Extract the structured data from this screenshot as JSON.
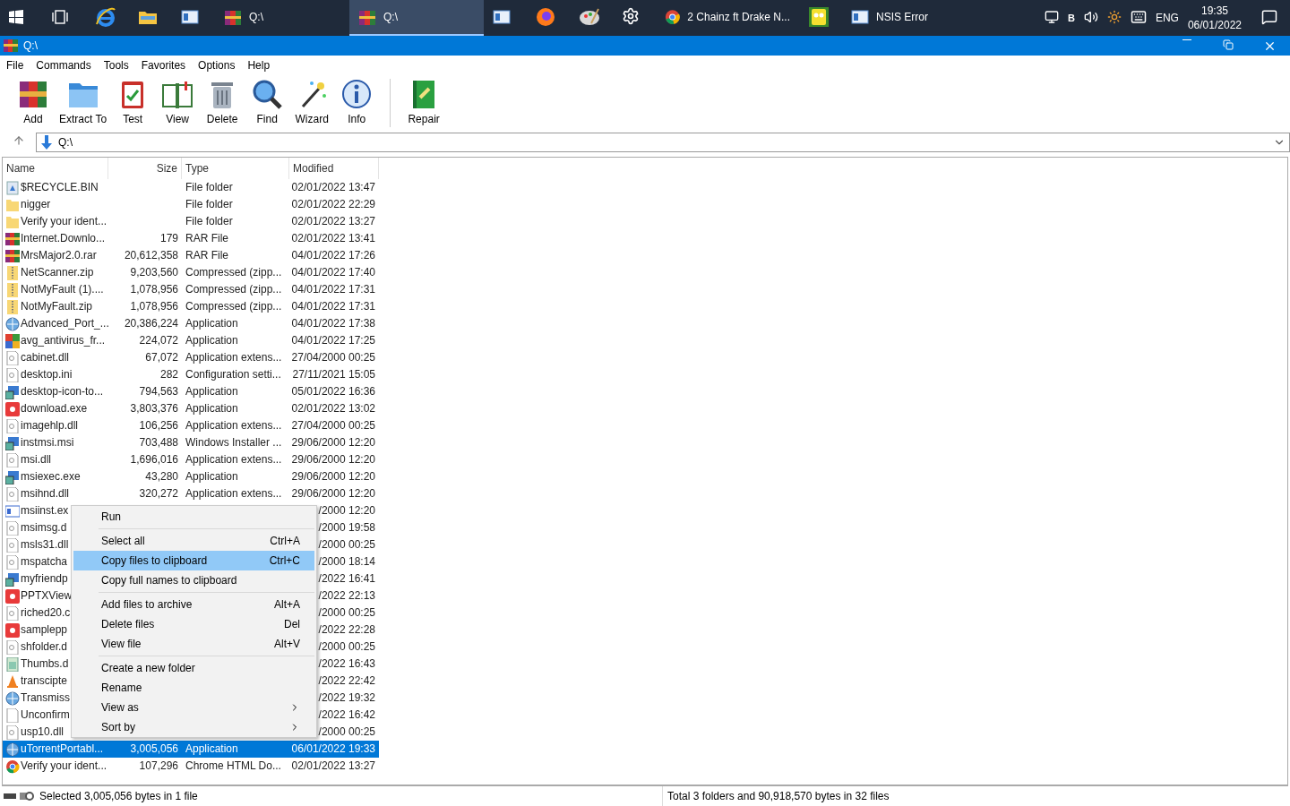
{
  "taskbar": {
    "items": [
      {
        "kind": "start",
        "selected": false
      },
      {
        "kind": "taskview",
        "selected": false
      },
      {
        "kind": "browser",
        "selected": false
      },
      {
        "kind": "explorer",
        "selected": false
      },
      {
        "kind": "app",
        "selected": false
      },
      {
        "kind": "archiver",
        "label": "Q:\\",
        "selected": false
      },
      {
        "kind": "archiver",
        "label": "Q:\\",
        "selected": true
      },
      {
        "kind": "app",
        "selected": false
      },
      {
        "kind": "fox",
        "selected": false
      },
      {
        "kind": "paint",
        "selected": false
      },
      {
        "kind": "gear",
        "selected": false
      },
      {
        "kind": "chrome",
        "label": "2 Chainz ft Drake N...",
        "selected": false
      },
      {
        "kind": "sponge",
        "selected": false
      },
      {
        "kind": "app",
        "label": "NSIS Error",
        "selected": false
      }
    ],
    "tray": {
      "badge": "B",
      "language": "ENG",
      "time": "19:35",
      "date": "06/01/2022"
    }
  },
  "window": {
    "title": "Q:\\"
  },
  "menu": [
    "File",
    "Commands",
    "Tools",
    "Favorites",
    "Options",
    "Help"
  ],
  "toolbar": [
    {
      "label": "Add",
      "kind": "add"
    },
    {
      "label": "Extract To",
      "kind": "extract"
    },
    {
      "label": "Test",
      "kind": "test"
    },
    {
      "label": "View",
      "kind": "view"
    },
    {
      "label": "Delete",
      "kind": "delete"
    },
    {
      "label": "Find",
      "kind": "find"
    },
    {
      "label": "Wizard",
      "kind": "wizard"
    },
    {
      "label": "Info",
      "kind": "info"
    },
    {
      "label": "Repair",
      "kind": "repair"
    }
  ],
  "address": {
    "value": "Q:\\"
  },
  "table": {
    "columns": [
      "Name",
      "Size",
      "Type",
      "Modified"
    ],
    "rows": [
      {
        "kind": "bin",
        "name": "$RECYCLE.BIN",
        "type": "File folder",
        "modified": "02/01/2022 13:47",
        "selected": false
      },
      {
        "kind": "folder",
        "name": "nigger",
        "type": "File folder",
        "modified": "02/01/2022 22:29",
        "selected": false
      },
      {
        "kind": "folder",
        "name": "Verify your ident...",
        "type": "File folder",
        "modified": "02/01/2022 13:27",
        "selected": false
      },
      {
        "kind": "rar",
        "name": "Internet.Downlo...",
        "size": "179",
        "type": "RAR File",
        "modified": "02/01/2022 13:41",
        "selected": false
      },
      {
        "kind": "rar",
        "name": "MrsMajor2.0.rar",
        "size": "20,612,358",
        "type": "RAR File",
        "modified": "04/01/2022 17:26",
        "selected": false
      },
      {
        "kind": "zip",
        "name": "NetScanner.zip",
        "size": "9,203,560",
        "type": "Compressed (zipp...",
        "modified": "04/01/2022 17:40",
        "selected": false
      },
      {
        "kind": "zip",
        "name": "NotMyFault (1)....",
        "size": "1,078,956",
        "type": "Compressed (zipp...",
        "modified": "04/01/2022 17:31",
        "selected": false
      },
      {
        "kind": "zip",
        "name": "NotMyFault.zip",
        "size": "1,078,956",
        "type": "Compressed (zipp...",
        "modified": "04/01/2022 17:31",
        "selected": false
      },
      {
        "kind": "app",
        "name": "Advanced_Port_...",
        "size": "20,386,224",
        "type": "Application",
        "modified": "04/01/2022 17:38",
        "selected": false
      },
      {
        "kind": "color",
        "name": "avg_antivirus_fr...",
        "size": "224,072",
        "type": "Application",
        "modified": "04/01/2022 17:25",
        "selected": false
      },
      {
        "kind": "dll",
        "name": "cabinet.dll",
        "size": "67,072",
        "type": "Application extens...",
        "modified": "27/04/2000 00:25",
        "selected": false
      },
      {
        "kind": "dll",
        "name": "desktop.ini",
        "size": "282",
        "type": "Configuration setti...",
        "modified": "27/11/2021 15:05",
        "selected": false
      },
      {
        "kind": "installer",
        "name": "desktop-icon-to...",
        "size": "794,563",
        "type": "Application",
        "modified": "05/01/2022 16:36",
        "selected": false
      },
      {
        "kind": "red",
        "name": "download.exe",
        "size": "3,803,376",
        "type": "Application",
        "modified": "02/01/2022 13:02",
        "selected": false
      },
      {
        "kind": "dll",
        "name": "imagehlp.dll",
        "size": "106,256",
        "type": "Application extens...",
        "modified": "27/04/2000 00:25",
        "selected": false
      },
      {
        "kind": "installer",
        "name": "instmsi.msi",
        "size": "703,488",
        "type": "Windows Installer ...",
        "modified": "29/06/2000 12:20",
        "selected": false
      },
      {
        "kind": "dll",
        "name": "msi.dll",
        "size": "1,696,016",
        "type": "Application extens...",
        "modified": "29/06/2000 12:20",
        "selected": false
      },
      {
        "kind": "installer",
        "name": "msiexec.exe",
        "size": "43,280",
        "type": "Application",
        "modified": "29/06/2000 12:20",
        "selected": false
      },
      {
        "kind": "dll",
        "name": "msihnd.dll",
        "size": "320,272",
        "type": "Application extens...",
        "modified": "29/06/2000 12:20",
        "selected": false
      },
      {
        "kind": "window",
        "name": "msiinst.ex",
        "modified": "/2000 12:20",
        "selected": false
      },
      {
        "kind": "dll",
        "name": "msimsg.d",
        "modified": "/2000 19:58",
        "selected": false
      },
      {
        "kind": "dll",
        "name": "msls31.dll",
        "modified": "/2000 00:25",
        "selected": false
      },
      {
        "kind": "dll",
        "name": "mspatcha",
        "modified": "/2000 18:14",
        "selected": false
      },
      {
        "kind": "installer",
        "name": "myfriendp",
        "modified": "/2022 16:41",
        "selected": false
      },
      {
        "kind": "red",
        "name": "PPTXView",
        "modified": "/2022 22:13",
        "selected": false
      },
      {
        "kind": "dll",
        "name": "riched20.c",
        "modified": "/2000 00:25",
        "selected": false
      },
      {
        "kind": "red",
        "name": "samplepp",
        "modified": "/2022 22:28",
        "selected": false
      },
      {
        "kind": "dll",
        "name": "shfolder.d",
        "modified": "/2000 00:25",
        "selected": false
      },
      {
        "kind": "green",
        "name": "Thumbs.d",
        "modified": "/2022 16:43",
        "selected": false
      },
      {
        "kind": "cone",
        "name": "transcipte",
        "modified": "/2022 22:42",
        "selected": false
      },
      {
        "kind": "app",
        "name": "Transmiss",
        "modified": "/2022 19:32",
        "selected": false
      },
      {
        "kind": "blank",
        "name": "Unconfirm",
        "modified": "/2022 16:42",
        "selected": false
      },
      {
        "kind": "dll",
        "name": "usp10.dll",
        "modified": "/2000 00:25",
        "selected": false
      },
      {
        "kind": "app",
        "name": "uTorrentPortabl...",
        "size": "3,005,056",
        "type": "Application",
        "modified": "06/01/2022 19:33",
        "selected": true
      },
      {
        "kind": "chrome",
        "name": "Verify your ident...",
        "size": "107,296",
        "type": "Chrome HTML Do...",
        "modified": "02/01/2022 13:27",
        "selected": false
      }
    ]
  },
  "context_menu": [
    {
      "kind": "item",
      "label": "Run",
      "selected": false
    },
    {
      "kind": "separator"
    },
    {
      "kind": "item",
      "label": "Select all",
      "shortcut": "Ctrl+A",
      "selected": false
    },
    {
      "kind": "item",
      "label": "Copy files to clipboard",
      "shortcut": "Ctrl+C",
      "selected": true
    },
    {
      "kind": "item",
      "label": "Copy full names to clipboard",
      "selected": false
    },
    {
      "kind": "separator"
    },
    {
      "kind": "item",
      "label": "Add files to archive",
      "shortcut": "Alt+A",
      "selected": false
    },
    {
      "kind": "item",
      "label": "Delete files",
      "shortcut": "Del",
      "selected": false
    },
    {
      "kind": "item",
      "label": "View file",
      "shortcut": "Alt+V",
      "selected": false
    },
    {
      "kind": "separator"
    },
    {
      "kind": "item",
      "label": "Create a new folder",
      "selected": false
    },
    {
      "kind": "item",
      "label": "Rename",
      "selected": false
    },
    {
      "kind": "submenu",
      "label": "View as",
      "selected": false
    },
    {
      "kind": "submenu",
      "label": "Sort by",
      "selected": false
    }
  ],
  "status_bar": {
    "left": "Selected 3,005,056 bytes in 1 file",
    "right": "Total 3 folders and 90,918,570 bytes in 32 files"
  }
}
